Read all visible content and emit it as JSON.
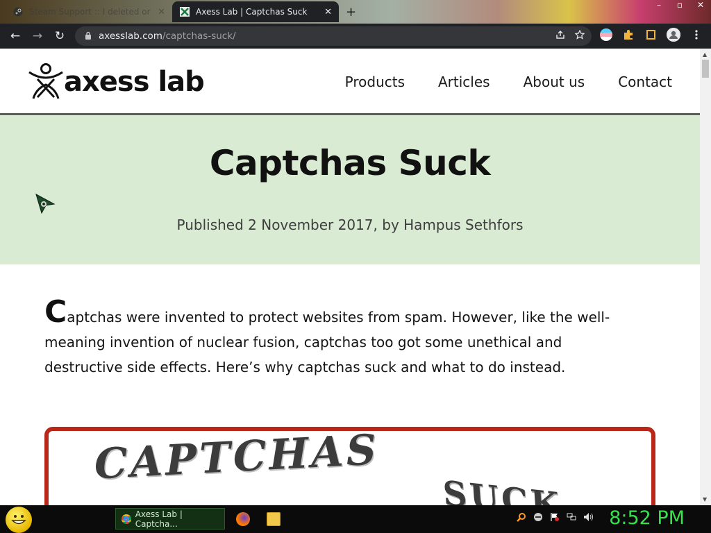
{
  "browser": {
    "tabs": [
      {
        "title": "Steam Support :: I deleted or los",
        "active": false
      },
      {
        "title": "Axess Lab | Captchas Suck",
        "active": true
      }
    ],
    "new_tab_label": "+",
    "close_glyph": "✕",
    "window_controls": [
      "–",
      "▫",
      "✕"
    ],
    "url_host": "axesslab.com",
    "url_path": "/captchas-suck/",
    "nav": {
      "back": "←",
      "forward": "→",
      "reload": "↻"
    },
    "omnibox_icons": [
      "share-icon",
      "star-icon"
    ],
    "extensions": [
      "trans-flag-extension-icon",
      "puzzle-extensions-icon",
      "side-panel-icon",
      "profile-icon",
      "kebab-menu-icon"
    ]
  },
  "site": {
    "logo_text": "axess lab",
    "nav": [
      "Products",
      "Articles",
      "About us",
      "Contact"
    ],
    "hero_bg": "#d9ebd3",
    "title": "Captchas Suck",
    "byline": "Published 2 November 2017, by Hampus Sethfors",
    "intro_dropcap": "C",
    "intro_rest": "aptchas were invented to protect websites from spam. However, like the well-meaning invention of nuclear fusion, captchas too got some unethical and destructive side effects. Here’s why captchas suck and what to do instead.",
    "figure_words": [
      "CAPTCHAS",
      "SUCK"
    ],
    "figure_border": "#b8281a"
  },
  "taskbar": {
    "task_title": "Axess Lab | Captcha...",
    "clock": "8:52 PM",
    "clock_color": "#36e34a"
  }
}
